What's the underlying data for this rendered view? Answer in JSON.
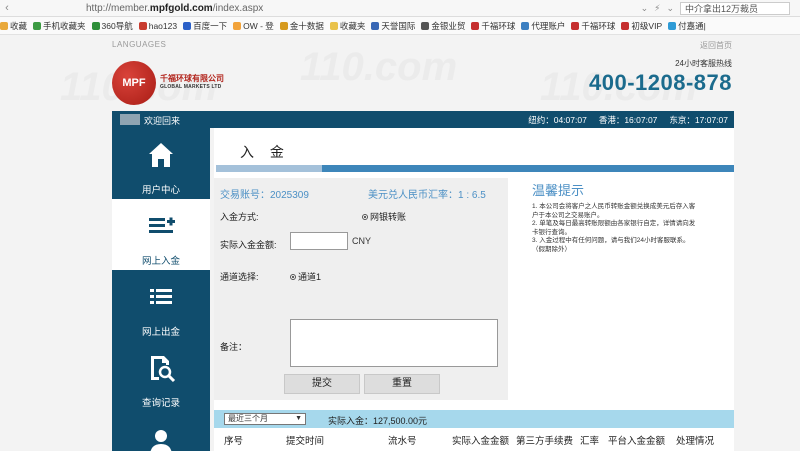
{
  "browser": {
    "url_prefix": "http://member.",
    "url_domain": "mpfgold.com",
    "url_suffix": "/index.aspx",
    "search_placeholder": "中介拿出12万裁员"
  },
  "bookmarks": [
    {
      "label": "收藏",
      "color": "#e9a93b"
    },
    {
      "label": "手机收藏夹",
      "color": "#3c9b43"
    },
    {
      "label": "360导航",
      "color": "#2e8f39"
    },
    {
      "label": "hao123",
      "color": "#c83b2e"
    },
    {
      "label": "百度一下",
      "color": "#2a5fc7"
    },
    {
      "label": "OW - 登",
      "color": "#f2a33a"
    },
    {
      "label": "金十数据",
      "color": "#d69a1e"
    },
    {
      "label": "收藏夹",
      "color": "#e9c24b"
    },
    {
      "label": "天誉国际",
      "color": "#3867b5"
    },
    {
      "label": "金银业贸",
      "color": "#555555"
    },
    {
      "label": "千福环球",
      "color": "#c62f2f"
    },
    {
      "label": "代理账户",
      "color": "#3b7fc1"
    },
    {
      "label": "千福环球",
      "color": "#c62f2f"
    },
    {
      "label": "初级VIP",
      "color": "#c62f2f"
    },
    {
      "label": "付嘉通|",
      "color": "#2f9bd6"
    }
  ],
  "top": {
    "languages": "LANGUAGES",
    "back_home": "返回首页"
  },
  "header": {
    "logo_mark": "MPF",
    "company_cn": "千福环球有限公司",
    "company_en": "GLOBAL MARKETS LTD",
    "hotline_label": "24小时客服热线",
    "hotline_number": "400-1208-878"
  },
  "welcome": {
    "text": "欢迎回来",
    "clocks": [
      "纽约：04:07:07",
      "香港：16:07:07",
      "东京：17:07:07"
    ]
  },
  "sidebar": {
    "items": [
      {
        "label": "用户中心",
        "icon": "home-icon"
      },
      {
        "label": "网上入金",
        "icon": "deposit-icon"
      },
      {
        "label": "网上出金",
        "icon": "withdraw-icon"
      },
      {
        "label": "查询记录",
        "icon": "search-records-icon"
      },
      {
        "label": "",
        "icon": "user-icon"
      }
    ]
  },
  "main": {
    "title": "入 金",
    "account": "交易账号：2025309",
    "rate": "美元兑人民币汇率：1 : 6.5",
    "method_label": "入金方式:",
    "method_value": "网银转账",
    "amount_label": "实际入金金额:",
    "amount_value": "",
    "currency": "CNY",
    "channel_label": "通道选择:",
    "channel_value": "通道1",
    "note_label": "备注：",
    "submit": "提交",
    "reset": "重置"
  },
  "tips": {
    "title": "温馨提示",
    "lines": [
      "1. 本公司会将客户之人民币转账金额兑换成美元后存入客",
      "户于本公司之交易账户。",
      "2. 单笔及每日最高转账限额由各家银行自定，详情请向发",
      "卡银行查询。",
      "3. 入金过程中有任何问题，请与我们24小时客服联系。",
      "（假期除外）"
    ]
  },
  "filter": {
    "range": "最近三个月",
    "total": "实际入金：127,500.00元"
  },
  "table": {
    "headers": [
      "序号",
      "提交时间",
      "流水号",
      "实际入金金额",
      "第三方手续费",
      "汇率",
      "平台入金金额",
      "处理情况"
    ]
  },
  "watermark": "110.com",
  "colors": {
    "brand": "#104d6d",
    "accent": "#4c90c5",
    "hotline": "#1b6b8d",
    "bar": "#3d86ba",
    "filter": "#a6d8ec"
  }
}
